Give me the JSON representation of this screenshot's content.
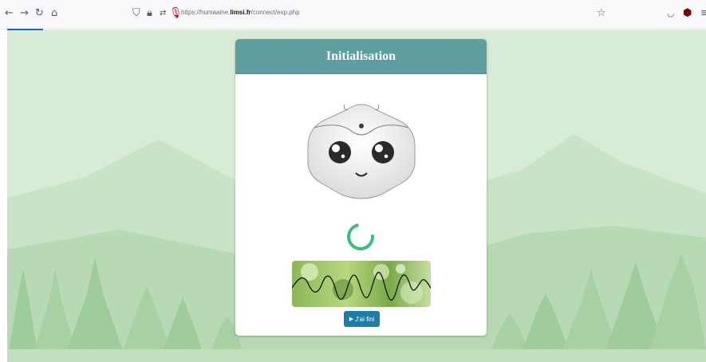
{
  "browser": {
    "url_prefix": "https://humaaine.",
    "url_domain": "limsi.fr",
    "url_path": "/connect/exp.php",
    "icons": [
      "back-arrow-icon",
      "forward-arrow-icon",
      "reload-icon",
      "home-icon",
      "shield-icon",
      "lock-icon",
      "permissions-icon",
      "microphone-icon",
      "star-icon",
      "pocket-icon",
      "ublock-icon",
      "menu-icon"
    ]
  },
  "card": {
    "title": "Initialisation",
    "button_icon": "▶",
    "button_label": "J'ai fini"
  },
  "colors": {
    "header": "#5f9ea0",
    "spinner": "#3dbd7d",
    "button": "#1a7ea8",
    "background": "#d8ebd6"
  }
}
